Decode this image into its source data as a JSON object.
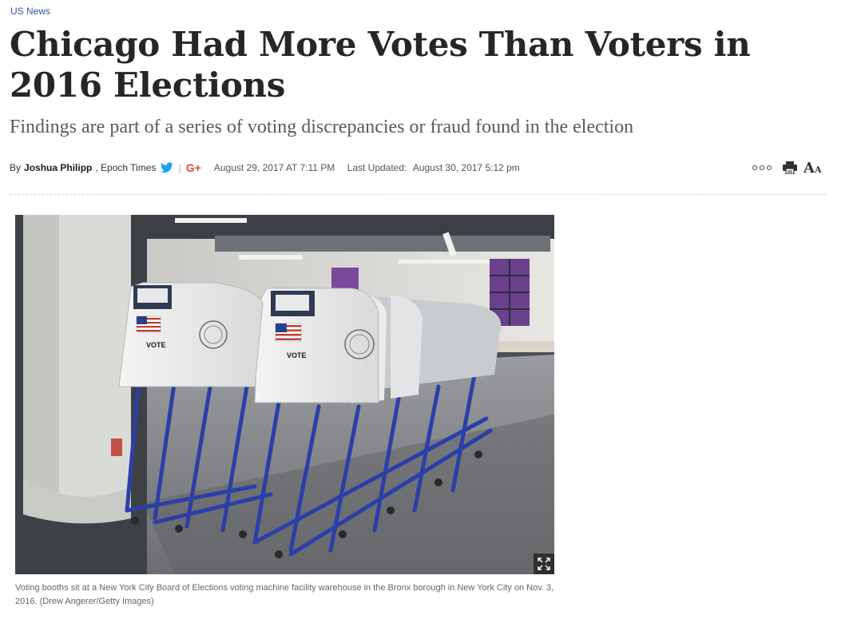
{
  "category": "US News",
  "headline": "Chicago Had More Votes Than Voters in 2016 Elections",
  "subheadline": "Findings are part of a series of voting discrepancies or fraud found in the election",
  "byline": {
    "by": "By",
    "author": "Joshua Philipp",
    "outlet": ", Epoch Times",
    "separator": "|",
    "gplus_label": "G+",
    "published": "August 29, 2017 AT 7:11 PM",
    "updated_label": "Last Updated:",
    "updated": "August 30, 2017 5:12 pm"
  },
  "tools": {
    "more_icon": "more-dots-icon",
    "print_icon": "print-icon",
    "font_big": "A",
    "font_small": "A"
  },
  "photo": {
    "booth_label": "VOTE",
    "expand_icon": "expand-icon"
  },
  "caption": "Voting booths sit at a New York City Board of Elections voting machine facility warehouse in the Bronx borough in New York City on Nov. 3, 2016. (Drew Angerer/Getty Images)",
  "colors": {
    "link_blue": "#2a5a9a",
    "twitter": "#1da1f2",
    "gplus": "#dd4b39",
    "booth_frame_blue": "#2b3fa8"
  }
}
